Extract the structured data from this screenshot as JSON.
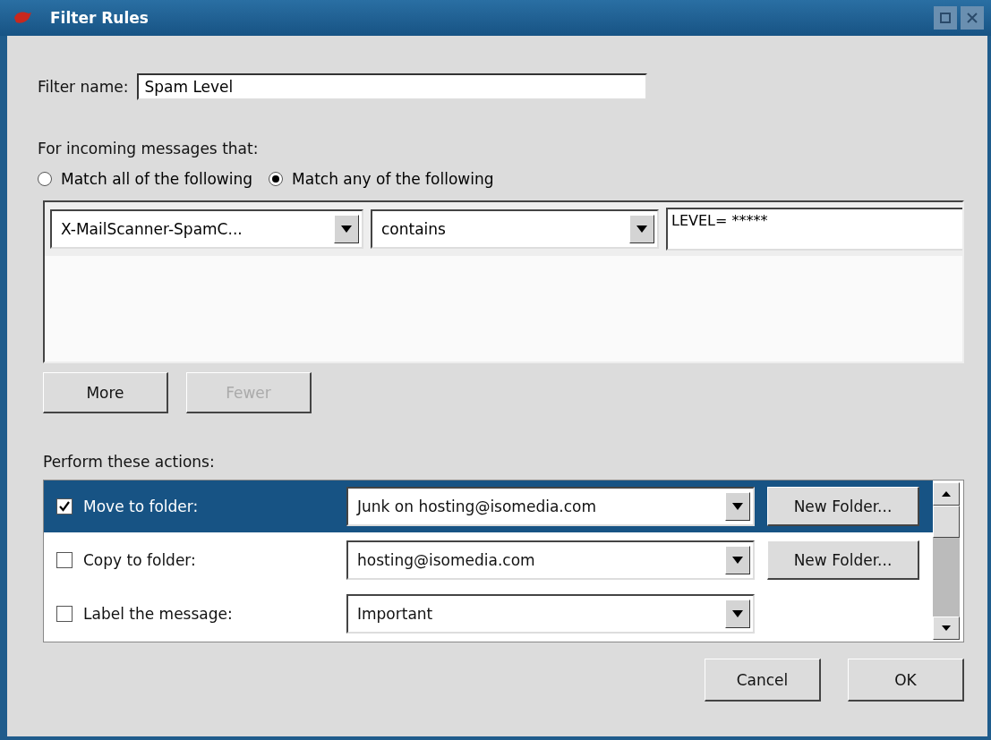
{
  "window": {
    "title": "Filter Rules"
  },
  "filter_name": {
    "label": "Filter name:",
    "value": "Spam Level"
  },
  "criteria_heading": "For incoming messages that:",
  "match_options": [
    {
      "label": "Match all of the following",
      "selected": false
    },
    {
      "label": "Match any of the following",
      "selected": true
    }
  ],
  "conditions": [
    {
      "field": "X-MailScanner-SpamC...",
      "operator": "contains",
      "value": "LEVEL= *****"
    }
  ],
  "condition_buttons": [
    {
      "label": "More",
      "disabled": false
    },
    {
      "label": "Fewer",
      "disabled": true
    }
  ],
  "actions_heading": "Perform these actions:",
  "actions": [
    {
      "label": "Move to folder:",
      "checked": true,
      "selected": true,
      "target": "Junk on hosting@isomedia.com",
      "button": "New Folder..."
    },
    {
      "label": "Copy to folder:",
      "checked": false,
      "selected": false,
      "target": "hosting@isomedia.com",
      "button": "New Folder..."
    },
    {
      "label": "Label the message:",
      "checked": false,
      "selected": false,
      "target": "Important"
    }
  ],
  "buttons": [
    "Cancel",
    "OK"
  ]
}
